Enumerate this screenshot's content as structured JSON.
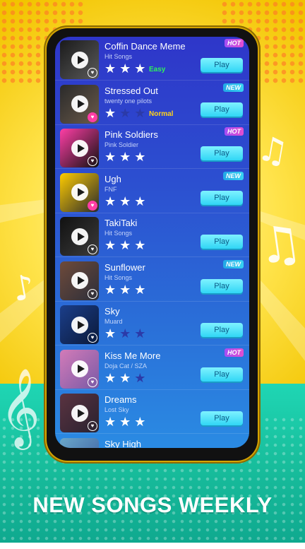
{
  "songs": [
    {
      "title": "Coffin Dance Meme",
      "artist": "Hit Songs",
      "stars_on": 3,
      "difficulty": "Easy",
      "difficulty_color": "#2ef25a",
      "badge": "HOT",
      "badge_type": "hot",
      "heart": "outline",
      "thumb_colors": [
        "#1b1b1b",
        "#5a5a5a"
      ],
      "play_label": "Play"
    },
    {
      "title": "Stressed Out",
      "artist": "twenty one pilots",
      "stars_on": 1,
      "difficulty": "Normal",
      "difficulty_color": "#ffd21a",
      "badge": "NEW",
      "badge_type": "new",
      "heart": "pink",
      "thumb_colors": [
        "#2a2a2a",
        "#6a5a4a"
      ],
      "play_label": "Play"
    },
    {
      "title": "Pink Soldiers",
      "artist": "Pink Soldier",
      "stars_on": 3,
      "difficulty": "",
      "difficulty_color": "#ffffff",
      "badge": "HOT",
      "badge_type": "hot",
      "heart": "outline",
      "thumb_colors": [
        "#ff3ea5",
        "#111111"
      ],
      "play_label": "Play"
    },
    {
      "title": "Ugh",
      "artist": "FNF",
      "stars_on": 3,
      "difficulty": "",
      "difficulty_color": "#ffffff",
      "badge": "NEW",
      "badge_type": "new",
      "heart": "pink",
      "thumb_colors": [
        "#ffcc00",
        "#2b2b2b"
      ],
      "play_label": "Play"
    },
    {
      "title": "TakiTaki",
      "artist": "Hit Songs",
      "stars_on": 3,
      "difficulty": "",
      "difficulty_color": "#ffffff",
      "badge": "",
      "badge_type": "",
      "heart": "outline",
      "thumb_colors": [
        "#111111",
        "#3c3c3c"
      ],
      "play_label": "Play"
    },
    {
      "title": "Sunflower",
      "artist": "Hit Songs",
      "stars_on": 3,
      "difficulty": "",
      "difficulty_color": "#ffffff",
      "badge": "NEW",
      "badge_type": "new",
      "heart": "outline",
      "thumb_colors": [
        "#6e4a3a",
        "#2d2f3a"
      ],
      "play_label": "Play"
    },
    {
      "title": "Sky",
      "artist": "Muard",
      "stars_on": 1,
      "difficulty": "",
      "difficulty_color": "#ffffff",
      "badge": "",
      "badge_type": "",
      "heart": "outline",
      "thumb_colors": [
        "#1b3e8a",
        "#0b1a3a"
      ],
      "play_label": "Play"
    },
    {
      "title": "Kiss Me More",
      "artist": "Doja Cat / SZA",
      "stars_on": 2,
      "difficulty": "",
      "difficulty_color": "#ffffff",
      "badge": "HOT",
      "badge_type": "hot",
      "heart": "outline",
      "thumb_colors": [
        "#d37bb8",
        "#7a5aa6"
      ],
      "play_label": "Play"
    },
    {
      "title": "Dreams",
      "artist": "Lost Sky",
      "stars_on": 3,
      "difficulty": "",
      "difficulty_color": "#ffffff",
      "badge": "",
      "badge_type": "",
      "heart": "outline",
      "thumb_colors": [
        "#5a3340",
        "#2a2230"
      ],
      "play_label": "Play"
    },
    {
      "title": "Sky High",
      "artist": "",
      "stars_on": 0,
      "difficulty": "",
      "difficulty_color": "#ffffff",
      "badge": "",
      "badge_type": "",
      "heart": "",
      "thumb_colors": [
        "#6aa7c9",
        "#3a5aa0"
      ],
      "play_label": ""
    }
  ],
  "footer": {
    "headline": "NEW SONGS WEEKLY"
  },
  "icons": {
    "play_overlay": "play-icon",
    "heart": "heart-icon",
    "star": "star-icon",
    "note": "music-note-icon",
    "treble": "treble-clef-icon"
  },
  "colors": {
    "background_yellow": "#ffe34a",
    "ground_teal": "#19c09e",
    "screen_blue": "#2c4fd0",
    "play_button": "#30d6f5"
  }
}
